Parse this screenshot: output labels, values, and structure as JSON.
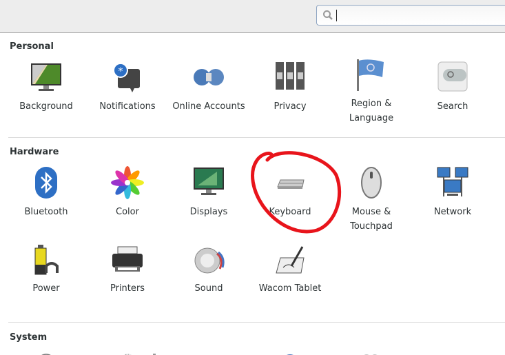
{
  "search": {
    "value": "",
    "icon": "search-icon"
  },
  "sections": [
    {
      "title": "Personal",
      "items": [
        {
          "label": "Background",
          "icon": "background-icon"
        },
        {
          "label": "Notifications",
          "icon": "notifications-icon"
        },
        {
          "label": "Online Accounts",
          "icon": "online-accounts-icon"
        },
        {
          "label": "Privacy",
          "icon": "privacy-icon"
        },
        {
          "label": "Region & Language",
          "icon": "region-flag-icon"
        },
        {
          "label": "Search",
          "icon": "search-settings-icon"
        }
      ]
    },
    {
      "title": "Hardware",
      "items": [
        {
          "label": "Bluetooth",
          "icon": "bluetooth-icon"
        },
        {
          "label": "Color",
          "icon": "color-icon"
        },
        {
          "label": "Displays",
          "icon": "displays-icon"
        },
        {
          "label": "Keyboard",
          "icon": "keyboard-icon"
        },
        {
          "label": "Mouse & Touchpad",
          "icon": "mouse-icon"
        },
        {
          "label": "Network",
          "icon": "network-icon"
        },
        {
          "label": "Power",
          "icon": "power-icon"
        },
        {
          "label": "Printers",
          "icon": "printer-icon"
        },
        {
          "label": "Sound",
          "icon": "sound-icon"
        },
        {
          "label": "Wacom Tablet",
          "icon": "wacom-tablet-icon"
        }
      ]
    },
    {
      "title": "System"
    }
  ],
  "annotation": {
    "color": "#e8141b",
    "shape": "hand-drawn circle around Keyboard"
  }
}
